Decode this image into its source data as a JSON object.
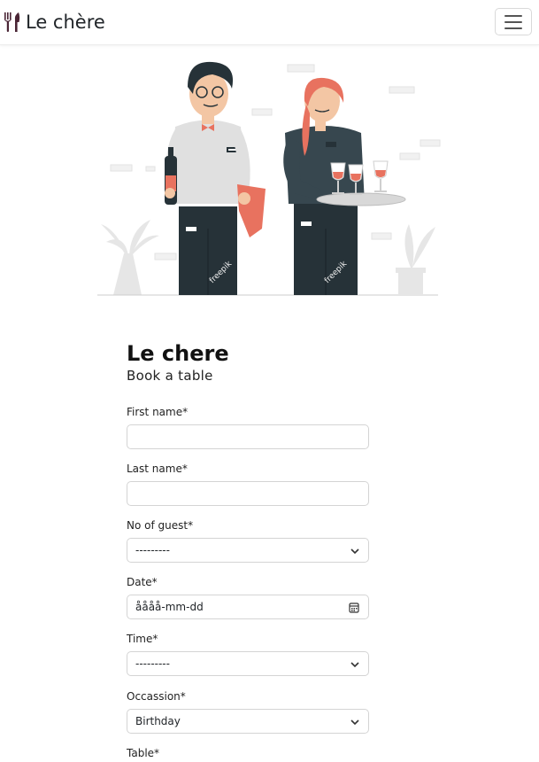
{
  "navbar": {
    "brand": "Le chère",
    "brand_icon": "utensils-icon",
    "menu_icon": "hamburger-menu-icon"
  },
  "hero": {
    "illustration": "waiters-illustration",
    "watermark": "freepik"
  },
  "form": {
    "title": "Le chere",
    "subtitle": "Book a table",
    "fields": {
      "first_name": {
        "label": "First name*",
        "value": ""
      },
      "last_name": {
        "label": "Last name*",
        "value": ""
      },
      "guests": {
        "label": "No of guest*",
        "value": "---------"
      },
      "date": {
        "label": "Date*",
        "value": "åååå-mm-dd"
      },
      "time": {
        "label": "Time*",
        "value": "---------"
      },
      "occasion": {
        "label": "Occassion*",
        "value": "Birthday"
      },
      "table": {
        "label": "Table*"
      }
    }
  },
  "colors": {
    "accent": "#e8725f",
    "dark": "#263238",
    "border": "#d4d4d4"
  }
}
